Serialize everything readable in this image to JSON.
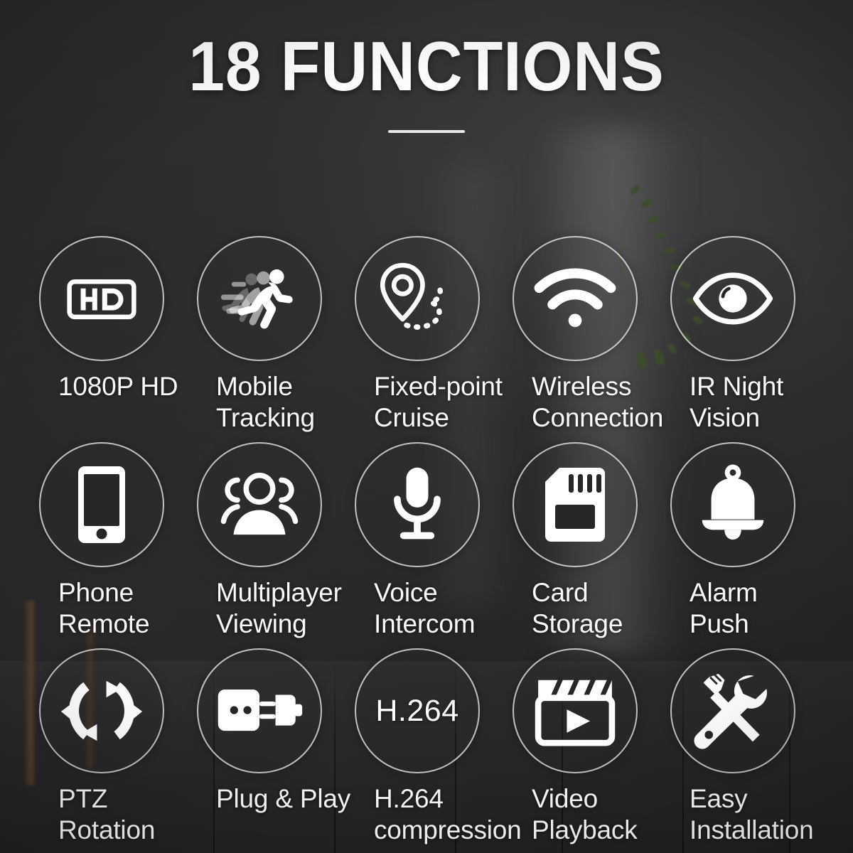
{
  "header": {
    "title": "18 FUNCTIONS",
    "divider": "horizontal-rule"
  },
  "theme": {
    "background": "#272728",
    "text": "#fafafa",
    "ring_stroke": "#ececec",
    "icon_fill": "#ffffff"
  },
  "features": [
    {
      "icon": "hd-badge-icon",
      "label": "1080P HD"
    },
    {
      "icon": "running-person-icon",
      "label": "Mobile\nTracking"
    },
    {
      "icon": "map-pin-route-icon",
      "label": "Fixed-point\nCruise"
    },
    {
      "icon": "wifi-icon",
      "label": "Wireless\nConnection"
    },
    {
      "icon": "eye-icon",
      "label": "IR Night\nVision"
    },
    {
      "icon": "smartphone-icon",
      "label": "Phone\nRemote"
    },
    {
      "icon": "people-group-icon",
      "label": "Multiplayer\nViewing"
    },
    {
      "icon": "microphone-icon",
      "label": "Voice\nIntercom"
    },
    {
      "icon": "sd-card-icon",
      "label": "Card\nStorage"
    },
    {
      "icon": "bell-icon",
      "label": "Alarm\nPush"
    },
    {
      "icon": "rotation-arrows-icon",
      "label": "PTZ\nRotation"
    },
    {
      "icon": "plug-socket-icon",
      "label": "Plug & Play"
    },
    {
      "icon": "h264-text-icon",
      "label": "H.264\ncompression",
      "icon_text": "H.264"
    },
    {
      "icon": "clapperboard-play-icon",
      "label": "Video\nPlayback"
    },
    {
      "icon": "wrench-screwdriver-icon",
      "label": "Easy\nInstallation"
    }
  ]
}
